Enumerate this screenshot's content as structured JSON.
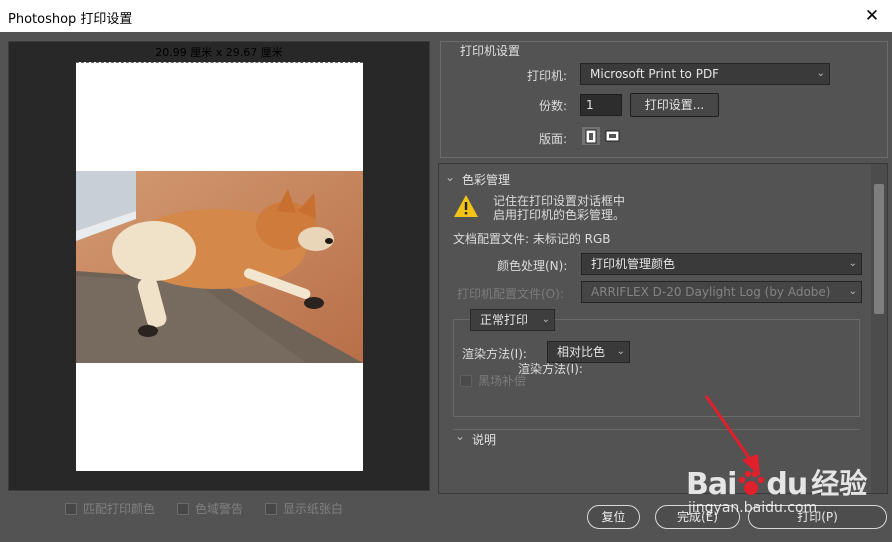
{
  "window": {
    "title": "Photoshop 打印设置",
    "close_glyph": "✕"
  },
  "preview": {
    "paper_size": "20.99 厘米 x 29.67 厘米",
    "checkboxes": [
      {
        "label": "匹配打印颜色",
        "checked": false
      },
      {
        "label": "色域警告",
        "checked": false
      },
      {
        "label": "显示纸张白",
        "checked": false
      }
    ]
  },
  "printer_settings": {
    "title": "打印机设置",
    "printer_label": "打印机:",
    "printer_value": "Microsoft Print to PDF",
    "copies_label": "份数:",
    "copies_value": "1",
    "print_settings_button": "打印设置...",
    "layout_label": "版面:"
  },
  "color_management": {
    "title": "色彩管理",
    "warning_line1": "记住在打印设置对话框中",
    "warning_line2": "启用打印机的色彩管理。",
    "doc_profile": "文档配置文件: 未标记的 RGB",
    "color_handling_label": "颜色处理(N):",
    "color_handling_value": "打印机管理颜色",
    "printer_profile_label": "打印机配置文件(O):",
    "printer_profile_value": "ARRIFLEX D-20 Daylight Log (by Adobe)",
    "print_mode_value": "正常打印",
    "rendering_label": "渲染方法(I):",
    "rendering_value": "相对比色",
    "black_point_label": "黑场补偿"
  },
  "description": {
    "title": "说明"
  },
  "buttons": {
    "reset": "复位",
    "done": "完成(E)",
    "print": "打印(P)"
  },
  "watermark": {
    "brand": "Bai",
    "brand2": "du",
    "cn": "经验",
    "url": "jingyan.baidu.com"
  },
  "icons": {
    "close": "close-icon",
    "chevron": "chevron-down-icon",
    "warning": "warning-icon",
    "portrait": "portrait-orientation-icon",
    "landscape": "landscape-orientation-icon"
  },
  "colors": {
    "accent_arrow": "#e0202a",
    "background": "#535353"
  }
}
